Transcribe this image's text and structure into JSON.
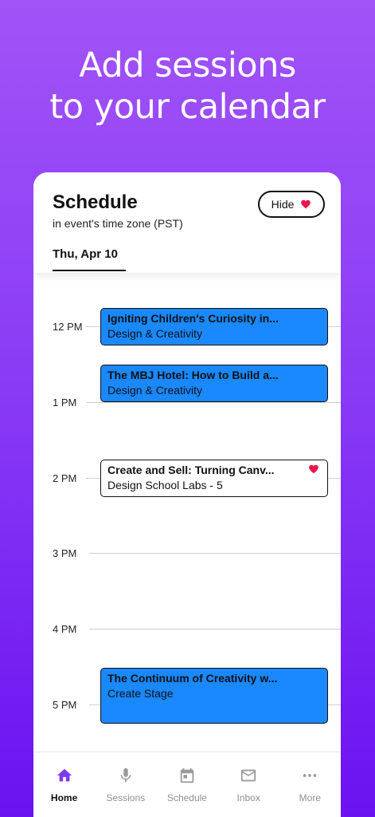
{
  "headline": {
    "line1": "Add sessions",
    "line2": "to your calendar"
  },
  "schedule": {
    "title": "Schedule",
    "subtitle": "in event's time zone (PST)",
    "hide_label": "Hide",
    "date_tab": "Thu, Apr 10"
  },
  "hours": [
    "12 PM",
    "1 PM",
    "2 PM",
    "3 PM",
    "4 PM",
    "5 PM"
  ],
  "events": [
    {
      "title": "Igniting Children's Curiosity in...",
      "subtitle": "Design & Creativity",
      "style": "blue"
    },
    {
      "title": "The MBJ Hotel: How to Build a...",
      "subtitle": "Design & Creativity",
      "style": "blue"
    },
    {
      "title": "Create and Sell: Turning Canv...",
      "subtitle": "Design School Labs - 5",
      "style": "white",
      "favorited": true
    },
    {
      "title": "The Continuum of Creativity w...",
      "subtitle": "Create Stage",
      "style": "blue"
    }
  ],
  "nav": [
    {
      "label": "Home",
      "icon": "home-icon",
      "active": true
    },
    {
      "label": "Sessions",
      "icon": "microphone-icon"
    },
    {
      "label": "Schedule",
      "icon": "calendar-icon"
    },
    {
      "label": "Inbox",
      "icon": "mail-icon"
    },
    {
      "label": "More",
      "icon": "more-dots-icon"
    }
  ],
  "colors": {
    "accent": "#7c3aed",
    "event_blue": "#1a88ff",
    "heart": "#e8174f",
    "gradient_top": "#a253f7",
    "gradient_bottom": "#6b12f1"
  }
}
